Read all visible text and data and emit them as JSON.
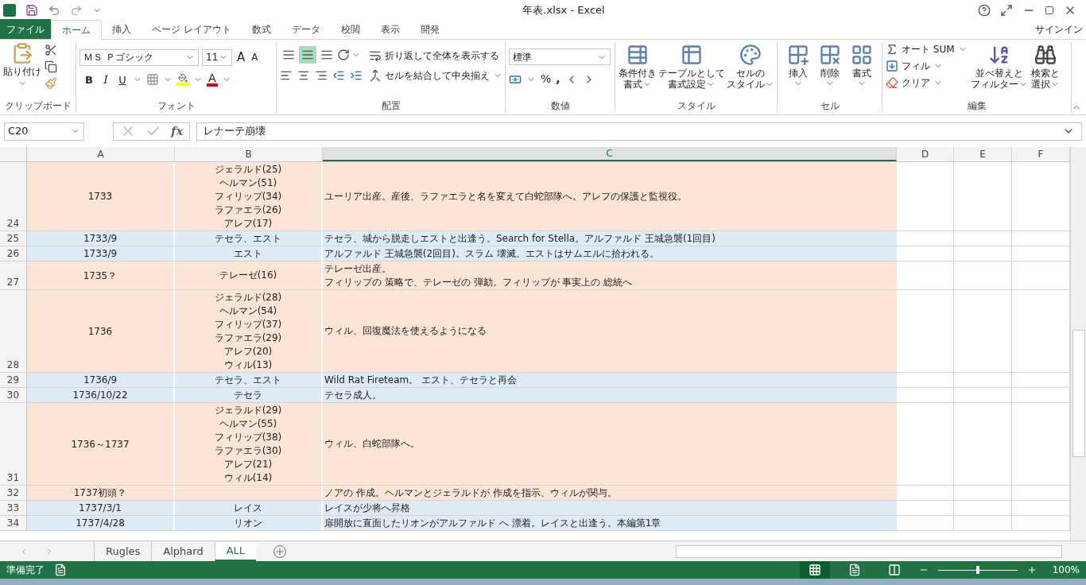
{
  "window": {
    "title": "年表.xlsx - Excel"
  },
  "tabs": [
    {
      "label": "ファイル",
      "selected": false,
      "kind": "file"
    },
    {
      "label": "ホーム",
      "selected": true,
      "kind": "tab"
    },
    {
      "label": "挿入",
      "selected": false,
      "kind": "tab"
    },
    {
      "label": "ページ レイアウト",
      "selected": false,
      "kind": "tab"
    },
    {
      "label": "数式",
      "selected": false,
      "kind": "tab"
    },
    {
      "label": "データ",
      "selected": false,
      "kind": "tab"
    },
    {
      "label": "校閲",
      "selected": false,
      "kind": "tab"
    },
    {
      "label": "表示",
      "selected": false,
      "kind": "tab"
    },
    {
      "label": "開発",
      "selected": false,
      "kind": "tab"
    }
  ],
  "sign_in": "サインイン",
  "ribbon": {
    "clipboard": {
      "label": "クリップボード",
      "paste": "貼り付け"
    },
    "font": {
      "label": "フォント",
      "font_name": "ＭＳ Ｐゴシック",
      "font_size": "11",
      "grow": "A",
      "shrink": "A",
      "bold": "B",
      "italic": "I",
      "underline": "U",
      "color_letter": "A"
    },
    "alignment": {
      "label": "配置",
      "valign": [
        {
          "selected": false
        },
        {
          "selected": true
        },
        {
          "selected": false
        }
      ],
      "wrap": "折り返して全体を表示する",
      "merge": "セルを結合して中央揃え"
    },
    "number": {
      "label": "数値",
      "format": "標準",
      "percent": "%",
      "comma": ","
    },
    "styles": {
      "label": "スタイル",
      "buttons": [
        {
          "line1": "条件付き",
          "line2": "書式"
        },
        {
          "line1": "テーブルとして",
          "line2": "書式設定"
        },
        {
          "line1": "セルの",
          "line2": "スタイル"
        }
      ]
    },
    "cells": {
      "label": "セル",
      "buttons": [
        "挿入",
        "削除",
        "書式"
      ]
    },
    "editing": {
      "label": "編集",
      "autosum": "オート SUM",
      "fill": "フィル",
      "clear": "クリア",
      "sort": {
        "line1": "並べ替えと",
        "line2": "フィルター"
      },
      "find": {
        "line1": "検索と",
        "line2": "選択"
      }
    }
  },
  "formula_bar": {
    "name_box": "C20",
    "fx": "fx",
    "value": "レナーテ崩壊"
  },
  "columns": [
    {
      "label": "A",
      "selected": false
    },
    {
      "label": "B",
      "selected": false
    },
    {
      "label": "C",
      "selected": true
    },
    {
      "label": "D",
      "selected": false
    },
    {
      "label": "E",
      "selected": false
    },
    {
      "label": "F",
      "selected": false
    }
  ],
  "rows": [
    {
      "number": "24",
      "color": "#fce4d6",
      "a": "1733",
      "b": [
        "ジェラルド(25)",
        "ヘルマン(51)",
        "フィリップ(34)",
        "ラファエラ(26)",
        "アレフ(17)"
      ],
      "c": [
        "ユーリア出産。産後、ラファエラと名を変えて白蛇部隊へ。アレフの保護と監視役。"
      ]
    },
    {
      "number": "25",
      "color": "#ddebf7",
      "a": "1733/9",
      "b": [
        "テセラ、エスト"
      ],
      "c": [
        "テセラ、城から脱走しエストと出逢う。Search for Stella。アルファルド 王城急襲(1回目)"
      ]
    },
    {
      "number": "26",
      "color": "#ddebf7",
      "a": "1733/9",
      "b": [
        "エスト"
      ],
      "c": [
        "アルファルド 王城急襲(2回目)。スラム 壊滅。エストはサムエルに拾われる。"
      ]
    },
    {
      "number": "27",
      "color": "#fce4d6",
      "a": "1735？",
      "b": [
        "テレーゼ(16)"
      ],
      "c": [
        "テレーゼ出産。",
        "フィリップの 策略で、テレーゼの 弾劾。フィリップが 事実上の 総統へ"
      ]
    },
    {
      "number": "28",
      "color": "#fce4d6",
      "a": "1736",
      "b": [
        "ジェラルド(28)",
        "ヘルマン(54)",
        "フィリップ(37)",
        "ラファエラ(29)",
        "アレフ(20)",
        "ウィル(13)"
      ],
      "c": [
        "ウィル、回復魔法を使えるようになる"
      ]
    },
    {
      "number": "29",
      "color": "#ddebf7",
      "a": "1736/9",
      "b": [
        "テセラ、エスト"
      ],
      "c": [
        "Wild Rat Fireteam。 エスト、テセラと再会"
      ]
    },
    {
      "number": "30",
      "color": "#ddebf7",
      "a": "1736/10/22",
      "b": [
        "テセラ"
      ],
      "c": [
        "テセラ成人。"
      ]
    },
    {
      "number": "31",
      "color": "#fce4d6",
      "a": "1736～1737",
      "b": [
        "ジェラルド(29)",
        "ヘルマン(55)",
        "フィリップ(38)",
        "ラファエラ(30)",
        "アレフ(21)",
        "ウィル(14)"
      ],
      "c": [
        "ウィル、白蛇部隊へ。"
      ]
    },
    {
      "number": "32",
      "color": "#fce4d6",
      "a": "1737初頭？",
      "b": [],
      "c": [
        "ノアの 作成。ヘルマンとジェラルドが 作成を指示、ウィルが関与。"
      ]
    },
    {
      "number": "33",
      "color": "#ddebf7",
      "a": "1737/3/1",
      "b": [
        "レイス"
      ],
      "c": [
        "レイスが少将へ昇格"
      ]
    },
    {
      "number": "34",
      "color": "#ddebf7",
      "a": "1737/4/28",
      "b": [
        "リオン"
      ],
      "c": [
        "扉開放に直面したリオンがアルファルド へ 漂着。レイスと出逢う。本編第1章"
      ]
    }
  ],
  "sheets": [
    {
      "label": "Rugles",
      "selected": false
    },
    {
      "label": "Alphard",
      "selected": false
    },
    {
      "label": "ALL",
      "selected": true
    }
  ],
  "status_bar": {
    "status": "準備完了",
    "views": [
      {
        "selected": true
      },
      {
        "selected": false
      },
      {
        "selected": false
      }
    ],
    "zoom": {
      "level": 0.5
    },
    "zoom_text": "100%"
  }
}
